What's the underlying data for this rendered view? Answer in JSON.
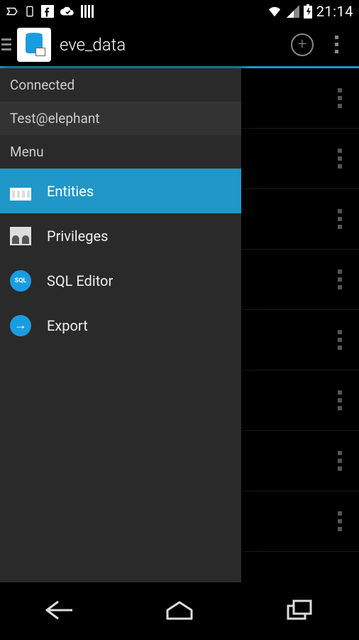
{
  "status_bar": {
    "time": "21:14"
  },
  "app_bar": {
    "title": "eve_data"
  },
  "drawer": {
    "connected_header": "Connected",
    "account": "Test@elephant",
    "menu_header": "Menu",
    "items": [
      {
        "label": "Entities",
        "icon": "entities-icon",
        "selected": true
      },
      {
        "label": "Privileges",
        "icon": "privileges-icon",
        "selected": false
      },
      {
        "label": "SQL Editor",
        "icon": "sql-icon",
        "selected": false
      },
      {
        "label": "Export",
        "icon": "export-icon",
        "selected": false
      }
    ],
    "sql_badge": "SQL",
    "export_arrow": "→"
  }
}
